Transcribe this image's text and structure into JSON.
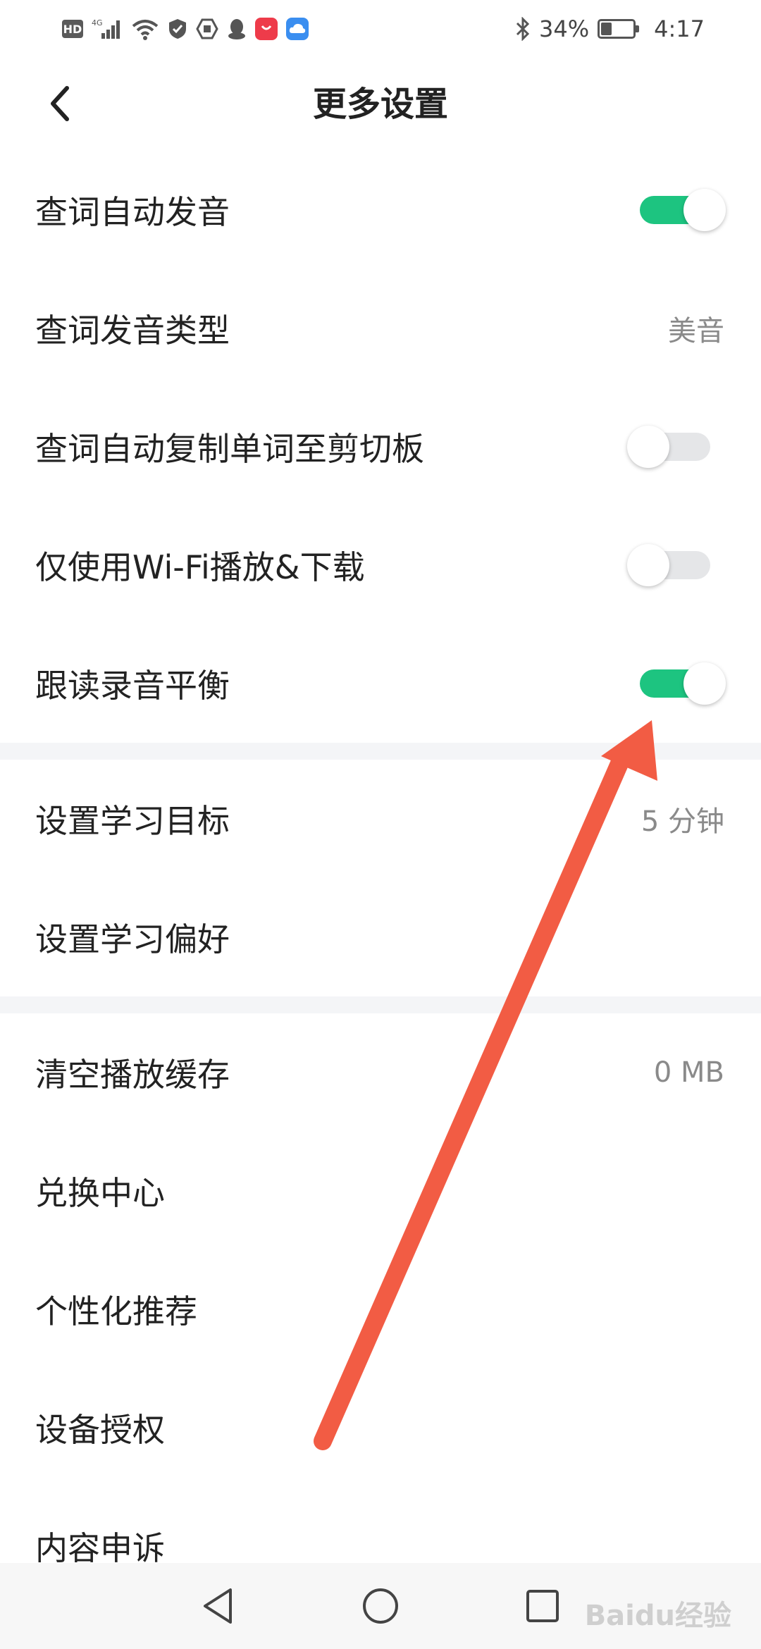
{
  "status_bar": {
    "network": "4G",
    "hd_label": "HD",
    "bluetooth": "✱",
    "battery_percent": "34%",
    "battery_level": 0.34,
    "time": "4:17",
    "icons": [
      "hd-icon",
      "signal-icon",
      "wifi-icon",
      "shield-icon",
      "vpn-icon",
      "qq-icon",
      "huawei-store-icon",
      "cloud-icon",
      "bluetooth-icon",
      "battery-icon"
    ]
  },
  "header": {
    "title": "更多设置",
    "back_icon": "chevron-left-icon"
  },
  "colors": {
    "accent": "#1dc480",
    "toggle_off": "#e5e6e8",
    "arrow": "#f25c44",
    "section_gap": "#f4f5f7"
  },
  "settings": {
    "group1": [
      {
        "label": "查词自动发音",
        "toggle": true
      },
      {
        "label": "查词发音类型",
        "value": "美音"
      },
      {
        "label": "查词自动复制单词至剪切板",
        "toggle": false
      },
      {
        "label": "仅使用Wi-Fi播放&下载",
        "toggle": false
      },
      {
        "label": "跟读录音平衡",
        "toggle": true
      }
    ],
    "group2": [
      {
        "label": "设置学习目标",
        "value": "5 分钟"
      },
      {
        "label": "设置学习偏好"
      }
    ],
    "group3": [
      {
        "label": "清空播放缓存",
        "value": "0 MB"
      },
      {
        "label": "兑换中心"
      },
      {
        "label": "个性化推荐"
      },
      {
        "label": "设备授权"
      },
      {
        "label": "内容申诉"
      }
    ]
  },
  "nav_bar": {
    "buttons": [
      "back-triangle-icon",
      "home-circle-icon",
      "recents-square-icon"
    ],
    "watermark": "Baidu经验"
  }
}
